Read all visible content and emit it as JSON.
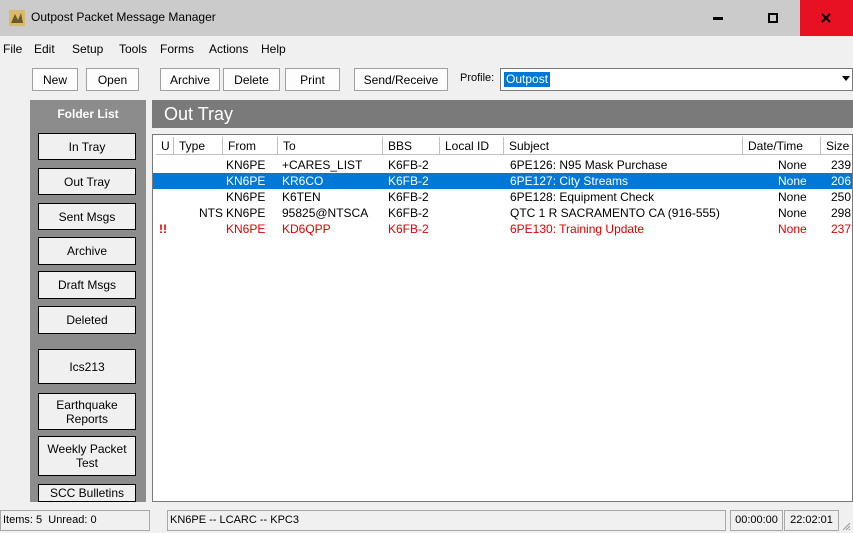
{
  "window": {
    "title": "Outpost Packet Message Manager",
    "controls": {
      "minimize": "minimize",
      "maximize": "maximize",
      "close": "x"
    }
  },
  "menu": [
    "File",
    "Edit",
    "Setup",
    "Tools",
    "Forms",
    "Actions",
    "Help"
  ],
  "toolbar": {
    "new": "New",
    "open": "Open",
    "archive": "Archive",
    "delete": "Delete",
    "print": "Print",
    "send_receive": "Send/Receive",
    "profile_label": "Profile:",
    "profile_value": "Outpost"
  },
  "sidebar": {
    "title": "Folder List",
    "folders": [
      "In Tray",
      "Out Tray",
      "Sent Msgs",
      "Archive",
      "Draft Msgs",
      "Deleted"
    ],
    "forms": [
      "Ics213",
      "Earthquake Reports",
      "Weekly Packet Test",
      "SCC Bulletins"
    ]
  },
  "main": {
    "title": "Out Tray",
    "columns": [
      "U",
      "Type",
      "From",
      "To",
      "BBS",
      "Local ID",
      "Subject",
      "Date/Time",
      "Size"
    ],
    "rows": [
      {
        "u": "",
        "type": "",
        "from": "KN6PE",
        "to": "+CARES_LIST",
        "bbs": "K6FB-2",
        "local_id": "",
        "subject": "6PE126: N95 Mask Purchase",
        "datetime": "None",
        "size": "239"
      },
      {
        "u": "",
        "type": "",
        "from": "KN6PE",
        "to": "KR6CO",
        "bbs": "K6FB-2",
        "local_id": "",
        "subject": "6PE127: City Streams",
        "datetime": "None",
        "size": "206"
      },
      {
        "u": "",
        "type": "",
        "from": "KN6PE",
        "to": "K6TEN",
        "bbs": "K6FB-2",
        "local_id": "",
        "subject": "6PE128: Equipment Check",
        "datetime": "None",
        "size": "250"
      },
      {
        "u": "",
        "type": "NTS",
        "from": "KN6PE",
        "to": "95825@NTSCA",
        "bbs": "K6FB-2",
        "local_id": "",
        "subject": "QTC 1 R SACRAMENTO CA (916-555)",
        "datetime": "None",
        "size": "298"
      },
      {
        "u": "!!",
        "type": "",
        "from": "KN6PE",
        "to": "KD6QPP",
        "bbs": "K6FB-2",
        "local_id": "",
        "subject": "6PE130: Training Update",
        "datetime": "None",
        "size": "237"
      }
    ],
    "selected_row": 1,
    "urgent_row": 4,
    "colors": {
      "selection": "#0078d7",
      "urgent": "#e00000"
    }
  },
  "status": {
    "items": "Items: 5",
    "unread": "Unread: 0",
    "station": "KN6PE -- LCARC -- KPC3",
    "timer": "00:00:00",
    "clock": "22:02:01"
  }
}
